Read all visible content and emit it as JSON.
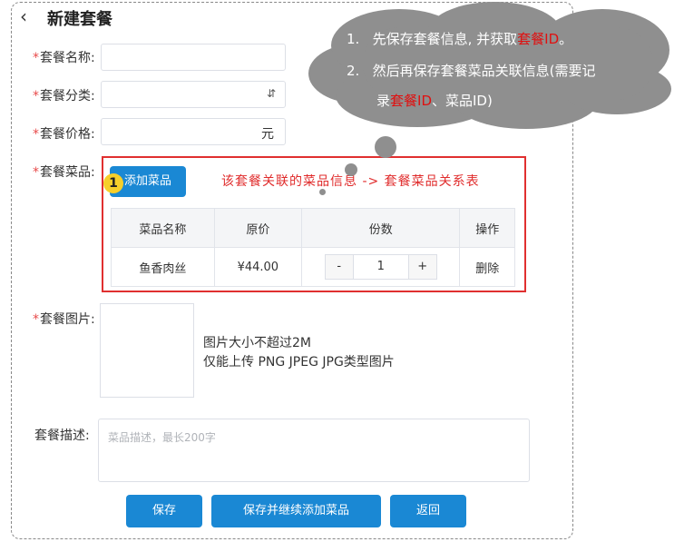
{
  "header": {
    "back_icon": "‹",
    "title": "新建套餐"
  },
  "form": {
    "required_mark": "*",
    "name_label": "套餐名称:",
    "category_label": "套餐分类:",
    "price_label": "套餐价格:",
    "price_unit": "元",
    "dishes_label": "套餐菜品:",
    "image_label": "套餐图片:",
    "desc_label": "套餐描述:",
    "desc_placeholder": "菜品描述，最长200字",
    "image_hint_1": "图片大小不超过2M",
    "image_hint_2": "仅能上传 PNG JPEG JPG类型图片"
  },
  "dishes": {
    "add_button": "添加菜品",
    "annotation": "该套餐关联的菜品信息 -> 套餐菜品关系表",
    "columns": [
      "菜品名称",
      "原价",
      "份数",
      "操作"
    ],
    "rows": [
      {
        "name": "鱼香肉丝",
        "price": "¥44.00",
        "minus": "-",
        "qty": "1",
        "plus": "+",
        "action": "删除"
      }
    ]
  },
  "buttons": {
    "save": "保存",
    "save_continue": "保存并继续添加菜品",
    "back": "返回"
  },
  "step_badge": "1",
  "callout": {
    "line1_num": "1.",
    "line1_a": "先保存套餐信息, 并获取",
    "line1_hl": "套餐ID",
    "line1_b": "。",
    "line2_num": "2.",
    "line2_a": "然后再保存套餐菜品关联信息(需要记",
    "line3_a": "录",
    "line3_hl": "套餐ID",
    "line3_b": "、菜品ID)"
  },
  "colors": {
    "accent": "#1a88d4",
    "annotation": "#e02b2b",
    "required": "#e84a4a",
    "callout": "#8f8f8f"
  }
}
